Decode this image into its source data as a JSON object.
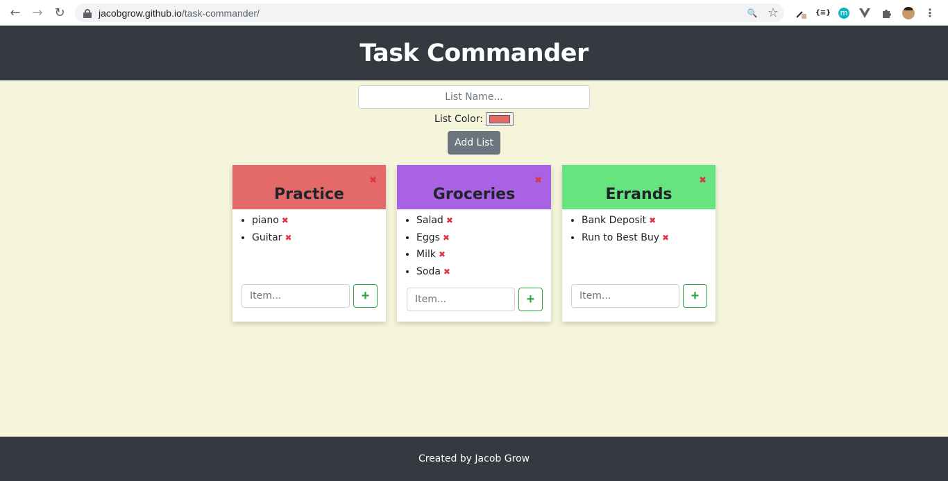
{
  "browser": {
    "url_host": "jacobgrow.github.io",
    "url_path": "/task-commander/",
    "back_icon": "←",
    "forward_icon": "→",
    "reload_icon": "↻",
    "zoom_icon": "🔍",
    "star_icon": "☆",
    "ext_code_label": "{≡}",
    "ext_m_label": "m",
    "menu_icon": "⋮"
  },
  "header": {
    "title": "Task Commander"
  },
  "form": {
    "list_name_placeholder": "List Name...",
    "color_label": "List Color:",
    "selected_color": "#e46a6a",
    "add_list_label": "Add List"
  },
  "lists": [
    {
      "name": "Practice",
      "color": "#e46a6a",
      "items": [
        "piano",
        "Guitar"
      ],
      "item_placeholder": "Item...",
      "add_label": "+",
      "delete_label": "✖",
      "item_delete_label": "✖"
    },
    {
      "name": "Groceries",
      "color": "#a862e3",
      "items": [
        "Salad",
        "Eggs",
        "Milk",
        "Soda"
      ],
      "item_placeholder": "Item...",
      "add_label": "+",
      "delete_label": "✖",
      "item_delete_label": "✖"
    },
    {
      "name": "Errands",
      "color": "#66e47f",
      "items": [
        "Bank Deposit",
        "Run to Best Buy"
      ],
      "item_placeholder": "Item...",
      "add_label": "+",
      "delete_label": "✖",
      "item_delete_label": "✖"
    }
  ],
  "footer": {
    "text": "Created by Jacob Grow"
  }
}
